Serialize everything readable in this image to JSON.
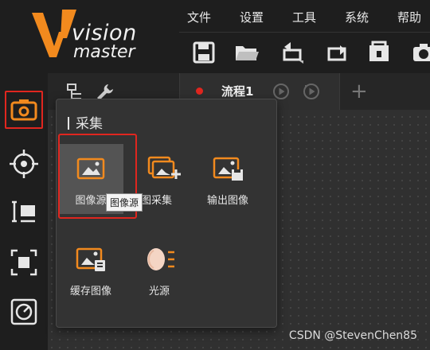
{
  "app": {
    "logo_line1": "vision",
    "logo_line2": "master",
    "accent": "#f28a1e",
    "alert": "#e0261f"
  },
  "menu": {
    "items": [
      {
        "label": "文件"
      },
      {
        "label": "设置"
      },
      {
        "label": "工具"
      },
      {
        "label": "系统"
      },
      {
        "label": "帮助"
      }
    ]
  },
  "toolbar": {
    "icons": [
      "save-icon",
      "open-folder-icon",
      "undo-icon",
      "redo-icon",
      "lock-icon",
      "camera-icon"
    ]
  },
  "left_rail": {
    "icons": [
      "camera-icon",
      "crosshair-icon",
      "measure-icon",
      "focus-frame-icon",
      "dial-icon"
    ],
    "selected": "camera-icon"
  },
  "tabs": {
    "flow_label": "流程1",
    "add_label": "+"
  },
  "popup": {
    "title": "采集",
    "items": [
      {
        "label": "图像源",
        "icon": "image-icon",
        "selected": true
      },
      {
        "label": "多图采集",
        "icon": "multi-image-add-icon"
      },
      {
        "label": "输出图像",
        "icon": "image-save-icon"
      },
      {
        "label": "缓存图像",
        "icon": "image-cache-icon"
      },
      {
        "label": "光源",
        "icon": "light-source-icon"
      }
    ],
    "tooltip": "图像源"
  },
  "watermark": "CSDN @StevenChen85"
}
